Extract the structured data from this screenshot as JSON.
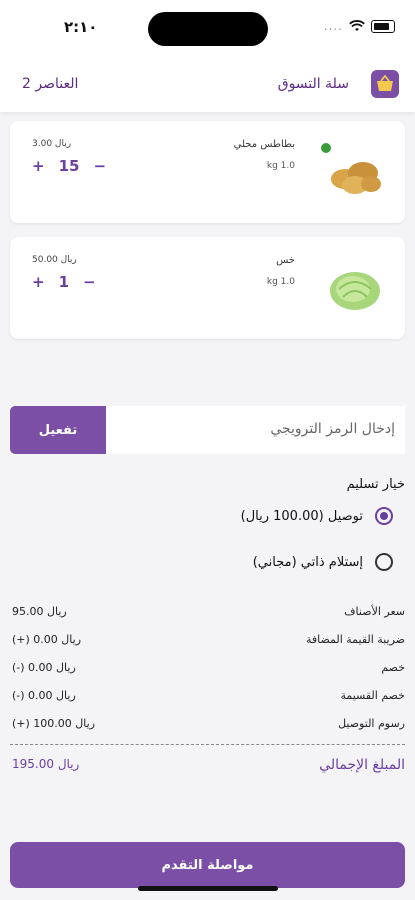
{
  "status": {
    "time": "٢:١٠",
    "signal": "....",
    "wifi": "wifi-icon",
    "battery": "battery-icon"
  },
  "header": {
    "title": "سلة التسوق",
    "items_count": "2 العناصر",
    "icon": "cart-basket-icon"
  },
  "items": [
    {
      "name": "بطاطس محلي",
      "weight": "kg 1.0",
      "price": "3.00 ريال",
      "qty": "15",
      "image": "potatoes-image",
      "plus": "+",
      "minus": "−"
    },
    {
      "name": "خس",
      "weight": "kg 1.0",
      "price": "50.00 ريال",
      "qty": "1",
      "image": "lettuce-image",
      "plus": "+",
      "minus": "−"
    }
  ],
  "promo": {
    "placeholder": "إدخال الرمز الترويجي",
    "button": "تفعيل"
  },
  "delivery": {
    "title": "خيار تسليم",
    "options": [
      {
        "label": "توصيل (100.00 ريال)",
        "selected": true
      },
      {
        "label": "إستلام ذاتي (مجاني)",
        "selected": false
      }
    ]
  },
  "summary": [
    {
      "label": "سعر الأصناف",
      "value": "95.00 ريال"
    },
    {
      "label": "ضريبة القيمة المضافة",
      "value": "(+) 0.00 ريال"
    },
    {
      "label": "خصم",
      "value": "(-) 0.00 ريال"
    },
    {
      "label": "خصم القسيمة",
      "value": "(-) 0.00 ريال"
    },
    {
      "label": "رسوم التوصيل",
      "value": "(+) 100.00 ريال"
    }
  ],
  "total": {
    "label": "المبلغ الإجمالي",
    "value": "195.00 ريال"
  },
  "continue_button": "مواصلة التقدم",
  "colors": {
    "accent": "#7b4fa5",
    "accent_text": "#6b3fa0"
  }
}
